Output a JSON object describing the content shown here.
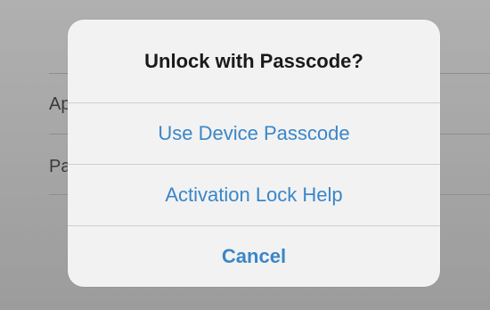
{
  "background": {
    "rows": [
      {
        "label": "Ap"
      },
      {
        "label": "Pa"
      }
    ]
  },
  "alert": {
    "title": "Unlock with Passcode?",
    "buttons": [
      {
        "label": "Use Device Passcode"
      },
      {
        "label": "Activation Lock Help"
      },
      {
        "label": "Cancel"
      }
    ]
  },
  "colors": {
    "accent": "#3a86c8",
    "title": "#1a1a1a",
    "dialog_bg": "#f2f2f2",
    "backdrop": "#a9a9a9"
  }
}
